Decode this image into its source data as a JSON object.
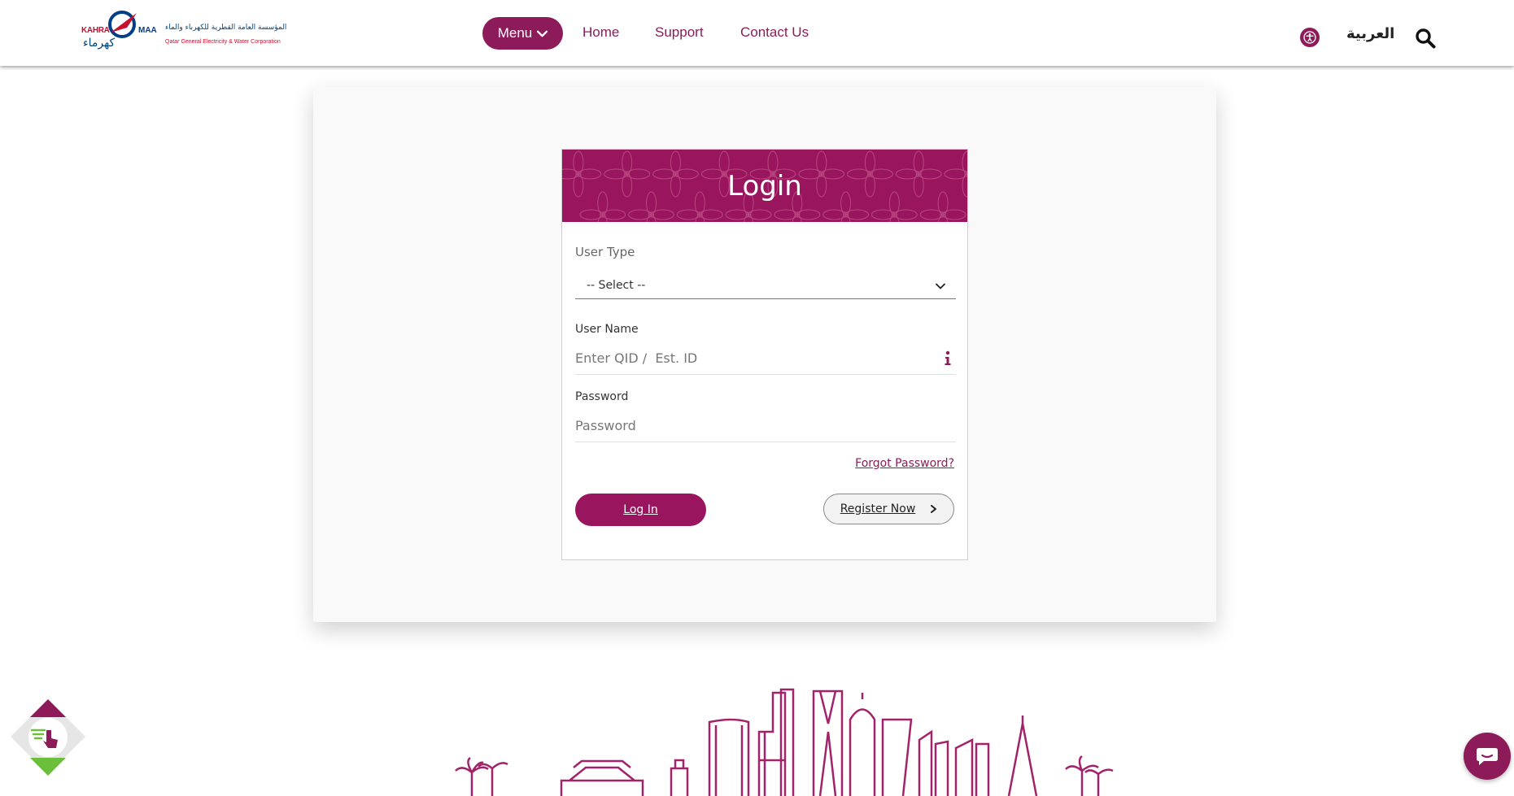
{
  "header": {
    "logo": {
      "latin_left": "KAHRA",
      "latin_right": "MAA",
      "arabic_name": "المؤسسة العامة القطرية للكهرباء والماء",
      "arabic_big": "كهرماء",
      "english_name": "Qatar General Electricity & Water Corporation"
    },
    "menu_label": "Menu",
    "nav": [
      "Home",
      "Support",
      "Contact Us"
    ],
    "language_label": "العربية",
    "icons": {
      "menu_chevron": "chevron-down-icon",
      "accessibility": "accessibility-icon",
      "search": "search-icon"
    }
  },
  "login": {
    "title": "Login",
    "user_type": {
      "label": "User Type",
      "selected": "-- Select --"
    },
    "username": {
      "label": "User Name",
      "placeholder": "Enter QID /  Est. ID",
      "value": ""
    },
    "password": {
      "label": "Password",
      "placeholder": "Password",
      "value": ""
    },
    "forgot_password": "Forgot Password?",
    "login_button": "Log In",
    "register_button": "Register Now"
  },
  "colors": {
    "brand": "#8d1b5a",
    "header_bg": "#99165f",
    "panel_bg": "#f9f9f9",
    "link": "#8d1b5a"
  },
  "widgets": {
    "accessibility_widget": "hand-pointer-icon",
    "chat": "chat-icon"
  }
}
